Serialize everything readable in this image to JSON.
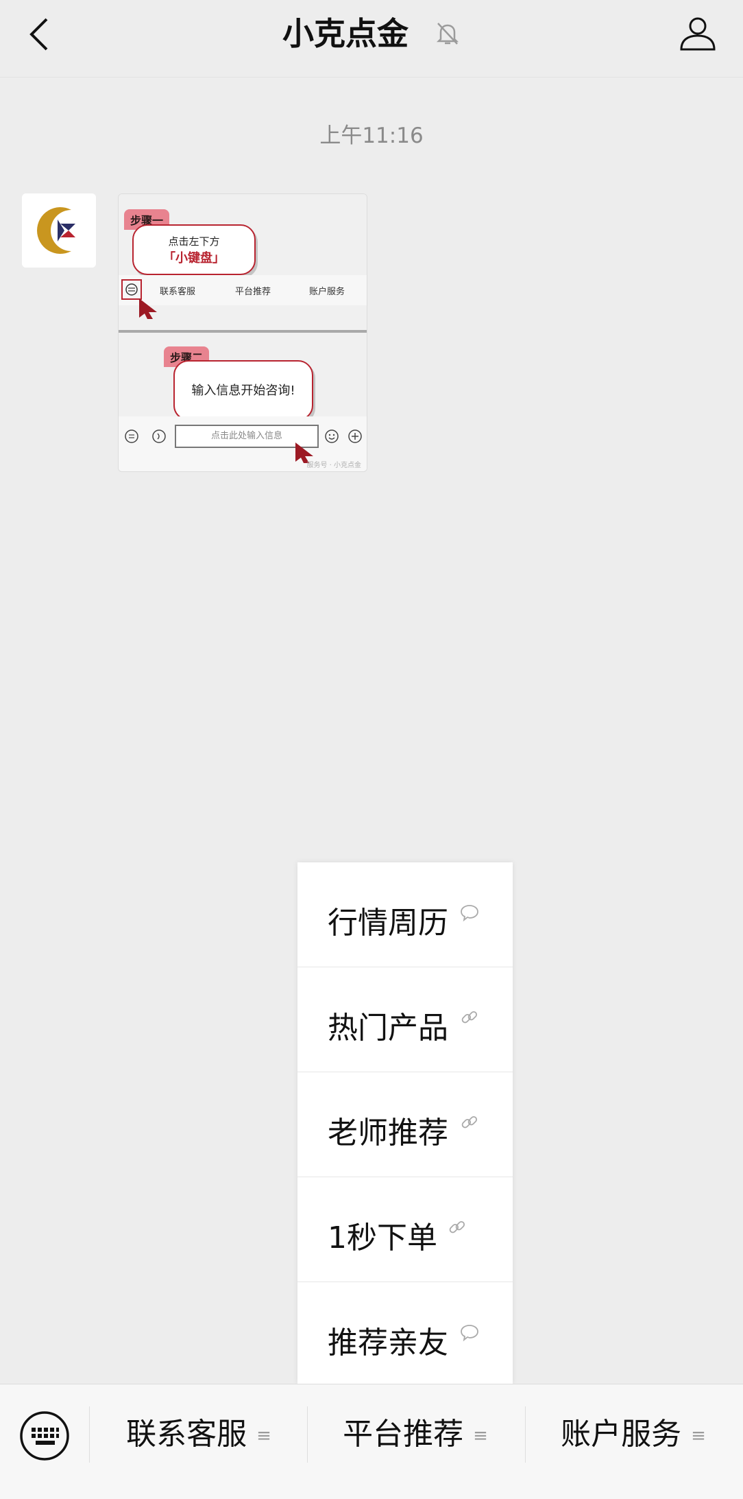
{
  "header": {
    "title": "小克点金",
    "back_icon": "chevron-left-icon",
    "mute_icon": "bell-off-icon",
    "profile_icon": "person-icon"
  },
  "chat": {
    "timestamp": "上午11:16",
    "message_image": {
      "step1_badge": "步骤一",
      "step1_line1": "点击左下方",
      "step1_line2": "「小键盘」",
      "mini_tabs": [
        "联系客服",
        "平台推荐",
        "账户服务"
      ],
      "step2_badge": "步骤二",
      "step2_text": "输入信息开始咨询!",
      "input_placeholder": "点击此处输入信息",
      "watermark": "服务号 · 小克点金"
    }
  },
  "popup_menu": {
    "items": [
      {
        "label": "行情周历",
        "icon": "chat-bubble-icon"
      },
      {
        "label": "热门产品",
        "icon": "link-icon"
      },
      {
        "label": "老师推荐",
        "icon": "link-icon"
      },
      {
        "label": "1秒下单",
        "icon": "link-icon"
      },
      {
        "label": "推荐亲友",
        "icon": "chat-bubble-icon"
      }
    ]
  },
  "bottom_menu": {
    "keyboard_icon": "keyboard-icon",
    "tabs": [
      {
        "label": "联系客服"
      },
      {
        "label": "平台推荐"
      },
      {
        "label": "账户服务"
      }
    ]
  },
  "colors": {
    "background": "#ededed",
    "accent_red": "#b8232f",
    "logo_gold": "#c9961f",
    "logo_navy": "#2b2f66"
  }
}
